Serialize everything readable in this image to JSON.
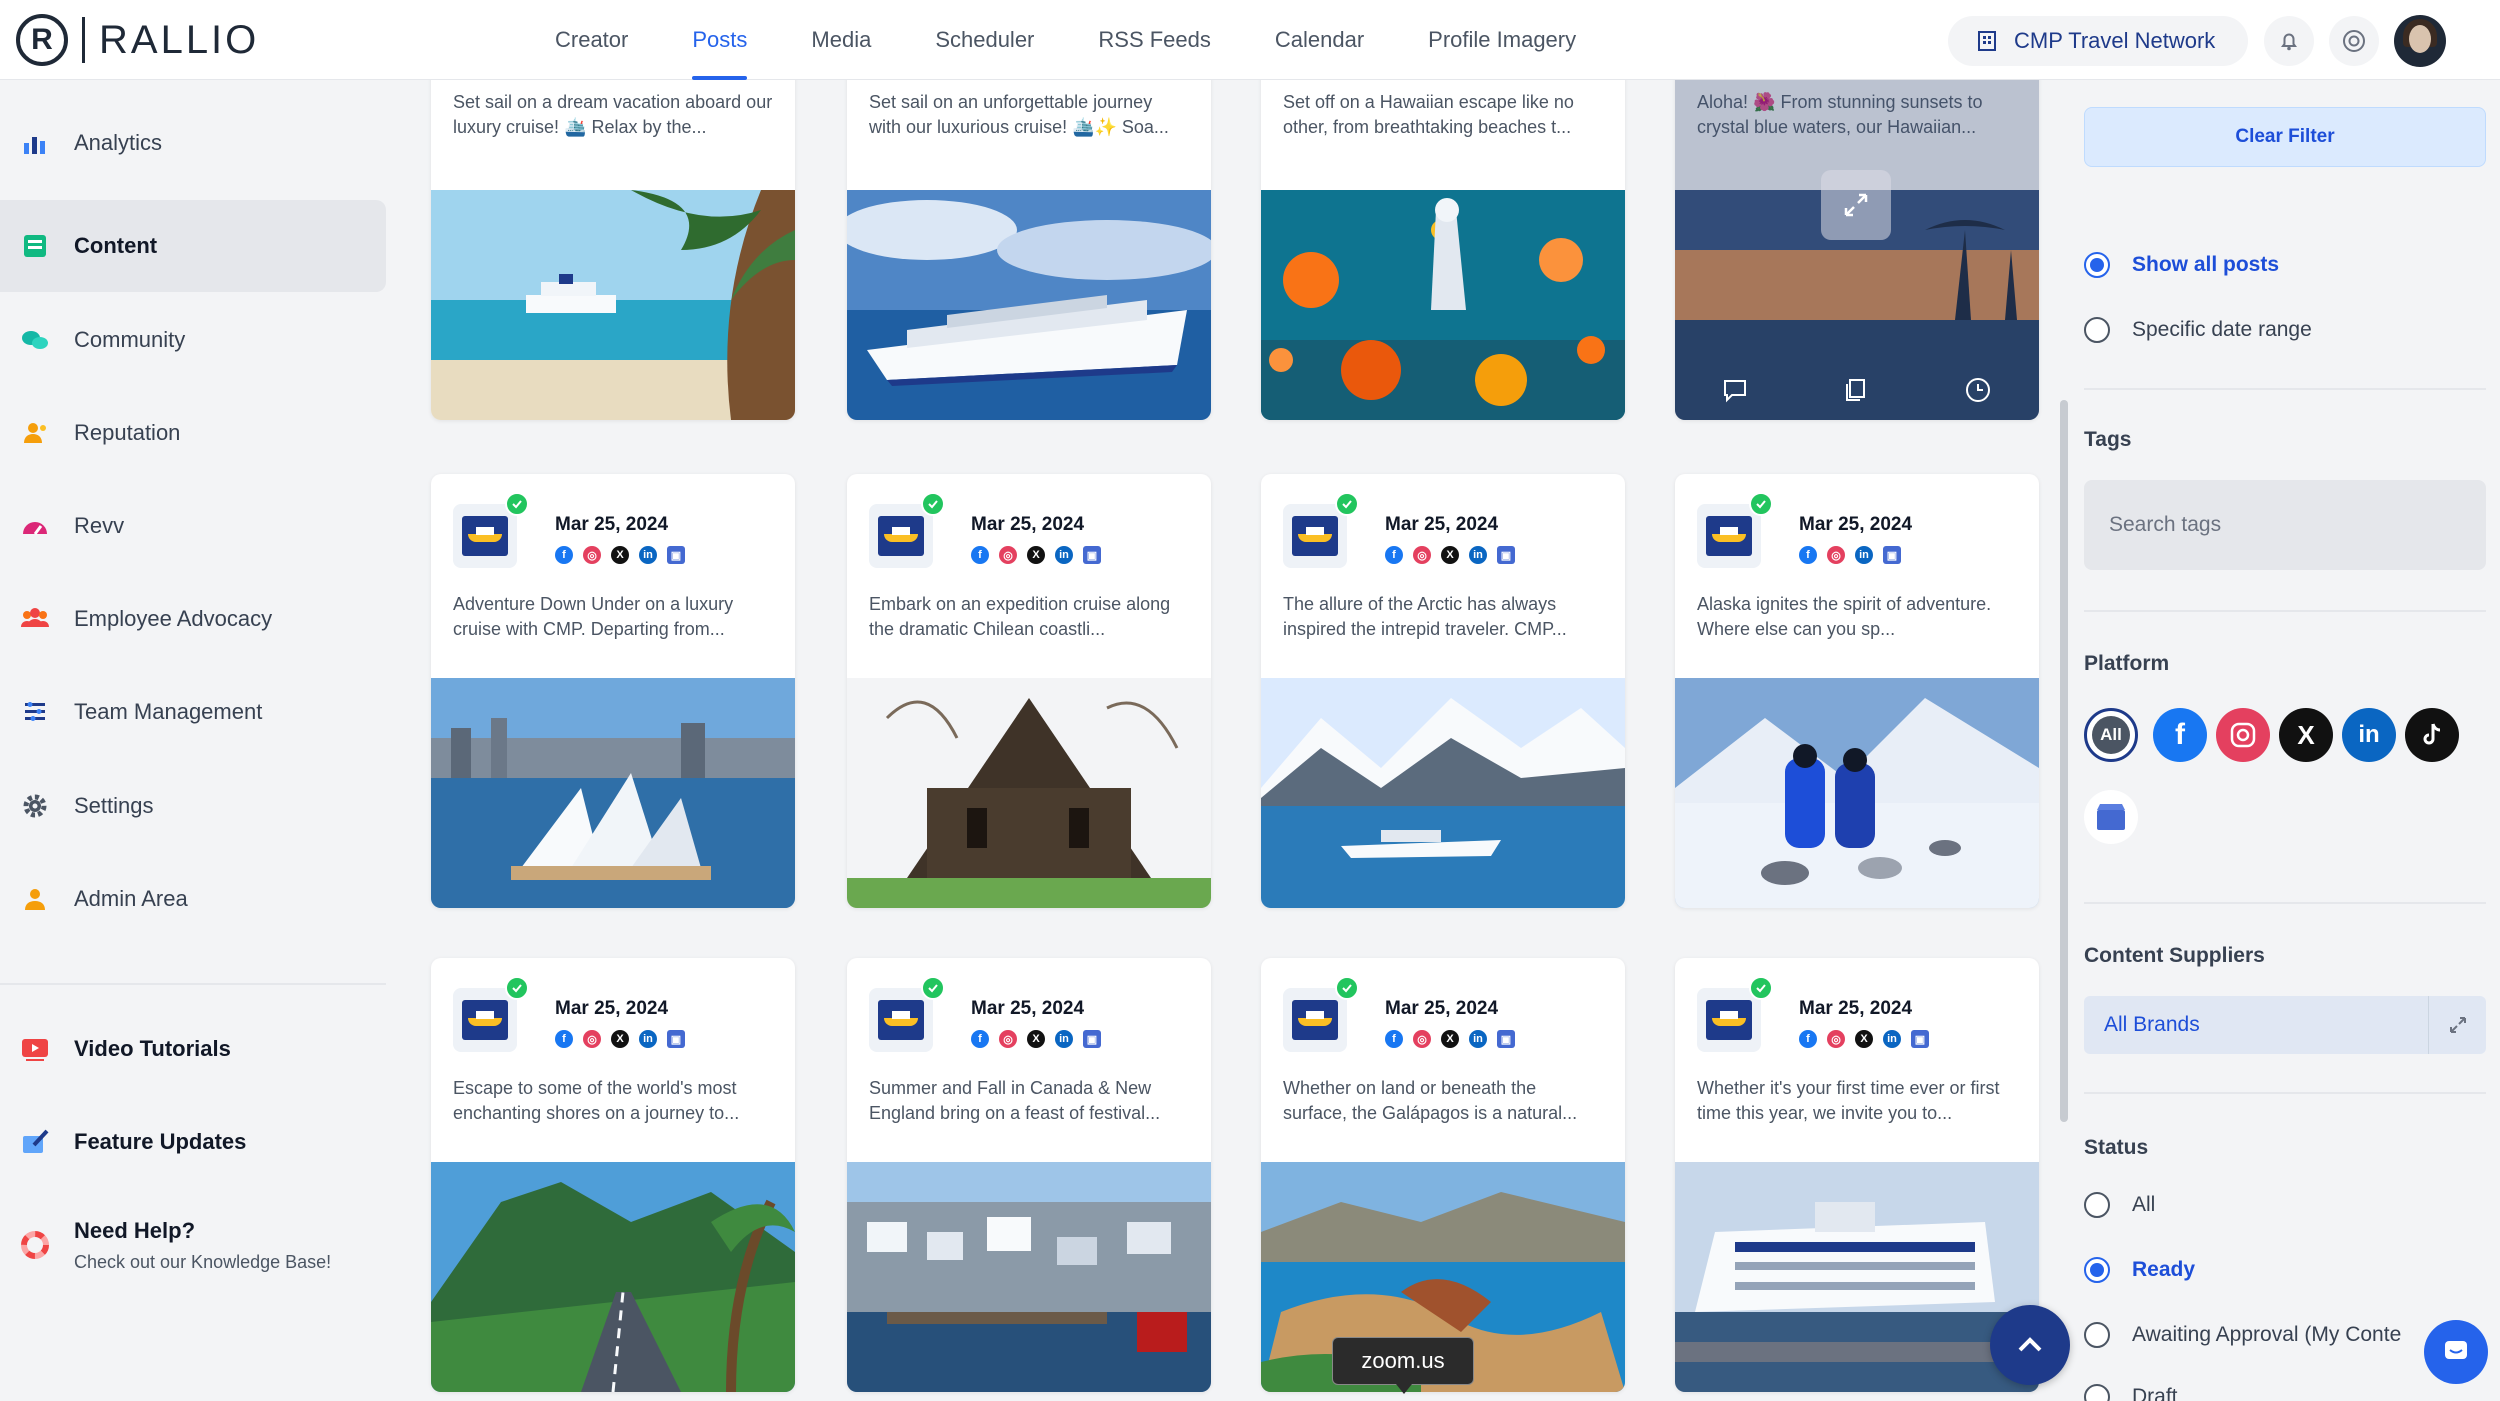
{
  "app": {
    "logo_text": "RALLIO"
  },
  "nav": {
    "tabs": [
      "Creator",
      "Posts",
      "Media",
      "Scheduler",
      "RSS Feeds",
      "Calendar",
      "Profile Imagery"
    ],
    "active": "Posts"
  },
  "account": {
    "name": "CMP Travel Network"
  },
  "sidebar": {
    "items": [
      {
        "label": "Analytics",
        "icon": "analytics-icon"
      },
      {
        "label": "Content",
        "icon": "content-icon"
      },
      {
        "label": "Community",
        "icon": "community-icon"
      },
      {
        "label": "Reputation",
        "icon": "reputation-icon"
      },
      {
        "label": "Revv",
        "icon": "revv-icon"
      },
      {
        "label": "Employee Advocacy",
        "icon": "employee-advocacy-icon"
      },
      {
        "label": "Team Management",
        "icon": "team-management-icon"
      },
      {
        "label": "Settings",
        "icon": "gear-icon"
      },
      {
        "label": "Admin Area",
        "icon": "admin-icon"
      }
    ],
    "bottom": [
      {
        "label": "Video Tutorials",
        "icon": "video-icon"
      },
      {
        "label": "Feature Updates",
        "icon": "feature-updates-icon"
      }
    ],
    "help": {
      "title": "Need Help?",
      "subtitle": "Check out our Knowledge Base!"
    },
    "active": "Content"
  },
  "posts_top": [
    {
      "text": "Set sail on a dream vacation aboard our luxury cruise! 🛳️ Relax by the...",
      "image": "cruise-ship-palm-beach"
    },
    {
      "text": "Set sail on an unforgettable journey with our luxurious cruise! 🛳️✨ Soa...",
      "image": "cruise-ship-ocean"
    },
    {
      "text": "Set off on a Hawaiian escape like no other, from breathtaking beaches t...",
      "image": "coral-reef-snorkeler"
    },
    {
      "text": "Aloha! 🌺 From stunning sunsets to crystal blue waters, our Hawaiian...",
      "image": "hawaii-sunset"
    }
  ],
  "posts": [
    {
      "date": "Mar 25, 2024",
      "networks": [
        "fb",
        "ig",
        "x",
        "li",
        "gb"
      ],
      "text": "Adventure Down Under on a luxury cruise with CMP. Departing from...",
      "image": "sydney-opera-house"
    },
    {
      "date": "Mar 25, 2024",
      "networks": [
        "fb",
        "ig",
        "x",
        "li",
        "gb"
      ],
      "text": "Embark on an expedition cruise along the dramatic Chilean coastli...",
      "image": "wooden-church"
    },
    {
      "date": "Mar 25, 2024",
      "networks": [
        "fb",
        "ig",
        "x",
        "li",
        "gb"
      ],
      "text": "The allure of the Arctic has always inspired the intrepid traveler. CMP...",
      "image": "arctic-ship-mountains"
    },
    {
      "date": "Mar 25, 2024",
      "networks": [
        "fb",
        "ig",
        "li",
        "gb"
      ],
      "text": "Alaska ignites the spirit of adventure. Where else can you sp...",
      "image": "alaska-dog-sled"
    },
    {
      "date": "Mar 25, 2024",
      "networks": [
        "fb",
        "ig",
        "x",
        "li",
        "gb"
      ],
      "text": "Escape to some of the world's most enchanting shores on a journey to...",
      "image": "tropical-mountain-road"
    },
    {
      "date": "Mar 25, 2024",
      "networks": [
        "fb",
        "ig",
        "x",
        "li",
        "gb"
      ],
      "text": "Summer and Fall in Canada & New England bring on a feast of festival...",
      "image": "harbor-town"
    },
    {
      "date": "Mar 25, 2024",
      "networks": [
        "fb",
        "ig",
        "x",
        "li",
        "gb"
      ],
      "text": "Whether on land or beneath the surface, the Galápagos is a natural...",
      "image": "galapagos-coast"
    },
    {
      "date": "Mar 25, 2024",
      "networks": [
        "fb",
        "ig",
        "x",
        "li",
        "gb"
      ],
      "text": "Whether it's your first time ever or first time this year, we invite you to...",
      "image": "cruise-ship-dock"
    }
  ],
  "filters": {
    "clear_label": "Clear Filter",
    "date_options": [
      {
        "label": "Show all posts",
        "selected": true
      },
      {
        "label": "Specific date range",
        "selected": false
      }
    ],
    "tags_label": "Tags",
    "tags_placeholder": "Search tags",
    "platform_label": "Platform",
    "platform_all": "All",
    "platforms": [
      "All",
      "facebook",
      "instagram",
      "x",
      "linkedin",
      "tiktok",
      "google-business"
    ],
    "suppliers_label": "Content Suppliers",
    "suppliers_value": "All Brands",
    "status_label": "Status",
    "status_options": [
      {
        "label": "All",
        "selected": false
      },
      {
        "label": "Ready",
        "selected": true
      },
      {
        "label": "Awaiting Approval (My Conte",
        "selected": false
      },
      {
        "label": "Draft",
        "selected": false
      }
    ]
  },
  "tooltip": {
    "text": "zoom.us"
  },
  "colors": {
    "accent": "#2563eb",
    "brand_navy": "#1e3a8a",
    "approved": "#22c55e"
  }
}
